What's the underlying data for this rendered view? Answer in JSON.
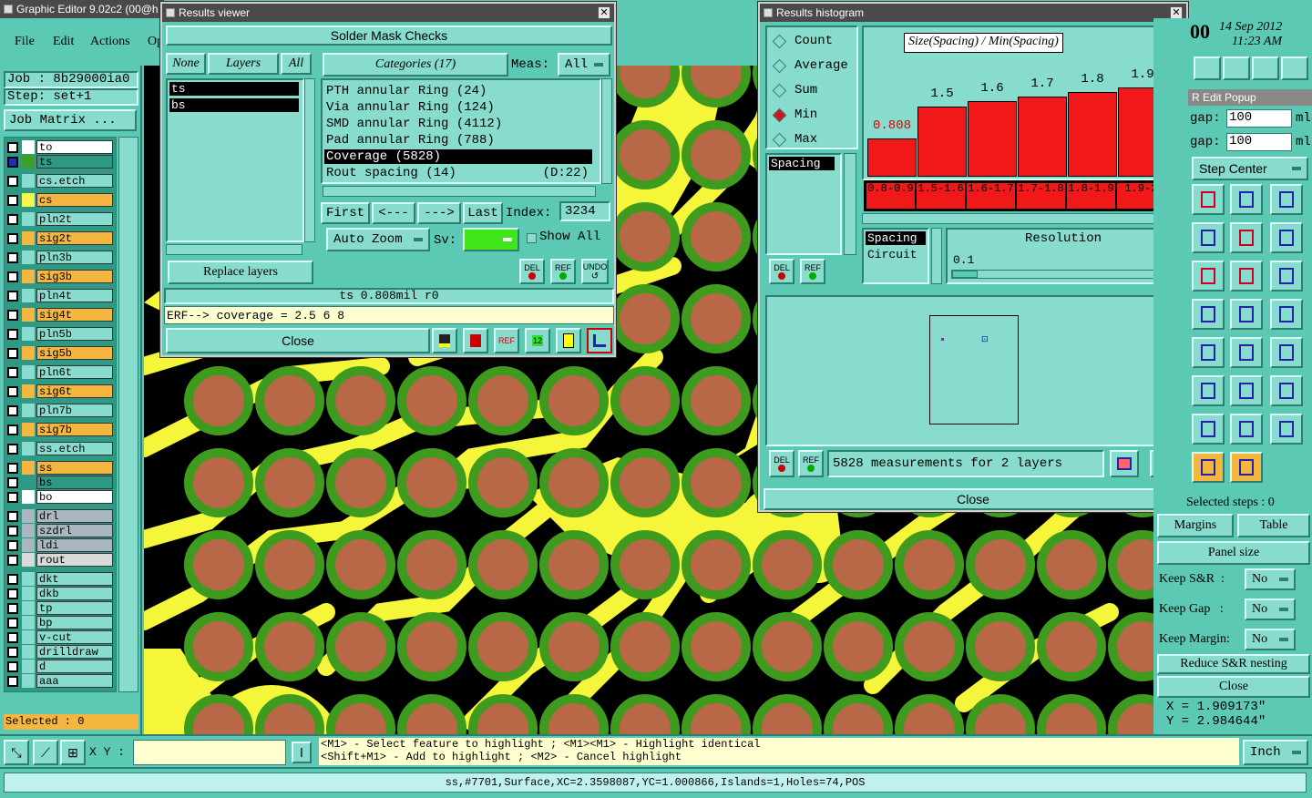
{
  "app": {
    "title": "Graphic Editor 9.02c2 (00@h",
    "clock_time": "11:23 AM",
    "clock_date": "14 Sep 2012",
    "clock_prefix": "00"
  },
  "menu": [
    {
      "label": "File"
    },
    {
      "label": "Edit"
    },
    {
      "label": "Actions"
    },
    {
      "label": "Op"
    }
  ],
  "job": {
    "job_line": "Job : 8b29000ia0",
    "step_line": "Step: set+1",
    "matrix_button": "Job Matrix ..."
  },
  "layers": [
    {
      "name": "to",
      "bg": "#ffffff",
      "cb": "#ffffff"
    },
    {
      "name": "ts",
      "bg": "#2e9a86",
      "cb": "#1c2dbf",
      "swatch": "#3d9e2b"
    },
    {
      "name": "cs.etch",
      "bg": "#87dccd",
      "cb": "#ffffff"
    },
    {
      "name": "cs",
      "bg": "#f5b63f",
      "cb": "#ffffff",
      "swatch": "#f5f54a"
    },
    {
      "name": "pln2t",
      "bg": "#87dccd",
      "cb": "#ffffff"
    },
    {
      "name": "sig2t",
      "bg": "#f5b63f",
      "cb": "#ffffff"
    },
    {
      "name": "pln3b",
      "bg": "#87dccd",
      "cb": "#ffffff"
    },
    {
      "name": "sig3b",
      "bg": "#f5b63f",
      "cb": "#ffffff"
    },
    {
      "name": "pln4t",
      "bg": "#87dccd",
      "cb": "#ffffff"
    },
    {
      "name": "sig4t",
      "bg": "#f5b63f",
      "cb": "#ffffff"
    },
    {
      "name": "pln5b",
      "bg": "#87dccd",
      "cb": "#ffffff"
    },
    {
      "name": "sig5b",
      "bg": "#f5b63f",
      "cb": "#ffffff"
    },
    {
      "name": "pln6t",
      "bg": "#87dccd",
      "cb": "#ffffff"
    },
    {
      "name": "sig6t",
      "bg": "#f5b63f",
      "cb": "#ffffff"
    },
    {
      "name": "pln7b",
      "bg": "#87dccd",
      "cb": "#ffffff"
    },
    {
      "name": "sig7b",
      "bg": "#f5b63f",
      "cb": "#ffffff"
    },
    {
      "name": "ss.etch",
      "bg": "#87dccd",
      "cb": "#ffffff"
    },
    {
      "name": "ss",
      "bg": "#f5b63f",
      "cb": "#ffffff"
    },
    {
      "name": "bs",
      "bg": "#2e9a86",
      "cb": "#ffffff"
    },
    {
      "name": "bo",
      "bg": "#ffffff",
      "cb": "#ffffff"
    },
    {
      "name": "drl",
      "bg": "#a9b8c0",
      "cb": "#ffffff"
    },
    {
      "name": "szdrl",
      "bg": "#a9b8c0",
      "cb": "#ffffff"
    },
    {
      "name": "ldi",
      "bg": "#a9b8c0",
      "cb": "#ffffff"
    },
    {
      "name": "rout",
      "bg": "#d9d9d9",
      "cb": "#ffffff"
    },
    {
      "name": "dkt",
      "bg": "#87dccd",
      "cb": "#ffffff"
    },
    {
      "name": "dkb",
      "bg": "#87dccd",
      "cb": "#ffffff"
    },
    {
      "name": "tp",
      "bg": "#87dccd",
      "cb": "#ffffff"
    },
    {
      "name": "bp",
      "bg": "#87dccd",
      "cb": "#ffffff"
    },
    {
      "name": "v-cut",
      "bg": "#87dccd",
      "cb": "#ffffff"
    },
    {
      "name": "drilldraw",
      "bg": "#87dccd",
      "cb": "#ffffff"
    },
    {
      "name": "d",
      "bg": "#87dccd",
      "cb": "#ffffff"
    },
    {
      "name": "aaa",
      "bg": "#87dccd",
      "cb": "#ffffff"
    }
  ],
  "layers_selected": "Selected : 0",
  "results_viewer": {
    "title": "Results viewer",
    "header": "Solder Mask Checks",
    "none_btn": "None",
    "layers_btn": "Layers",
    "all_btn": "All",
    "layer_list": [
      "ts",
      "bs"
    ],
    "categories_btn": "Categories (17)",
    "meas_label": "Meas:",
    "meas_value": "All",
    "categories": [
      {
        "name": "PTH annular Ring (24)",
        "extra": "",
        "selected": false
      },
      {
        "name": "Via annular Ring (124)",
        "extra": "",
        "selected": false
      },
      {
        "name": "SMD annular Ring (4112)",
        "extra": "",
        "selected": false
      },
      {
        "name": "Pad annular Ring (788)",
        "extra": "",
        "selected": false
      },
      {
        "name": "Coverage (5828)",
        "extra": "",
        "selected": true
      },
      {
        "name": "Rout spacing (14)",
        "extra": "(D:22)",
        "selected": false
      }
    ],
    "first": "First",
    "prev": "<---",
    "next": "--->",
    "last": "Last",
    "index_label": "Index:",
    "index_value": "3234",
    "auto_zoom": "Auto Zoom",
    "sv_label": "Sv:",
    "show_all": "Show All",
    "replace_layers": "Replace layers",
    "del": "DEL",
    "ref": "REF",
    "undo": "UNDO",
    "status": "ts 0.808mil  r0",
    "erf": "ERF--> coverage = 2.5 6 8",
    "close": "Close"
  },
  "histogram": {
    "title": "Results histogram",
    "modes": [
      {
        "label": "Count",
        "on": false
      },
      {
        "label": "Average",
        "on": false
      },
      {
        "label": "Sum",
        "on": false
      },
      {
        "label": "Min",
        "on": true
      },
      {
        "label": "Max",
        "on": false
      }
    ],
    "chart_title": "Size(Spacing) / Min(Spacing)",
    "bars": [
      {
        "value": "0.808",
        "range": "0.8-0.9",
        "v": 0.808,
        "red": true
      },
      {
        "value": "1.5",
        "range": "1.5-1.6",
        "v": 1.5
      },
      {
        "value": "1.6",
        "range": "1.6-1.7",
        "v": 1.6
      },
      {
        "value": "1.7",
        "range": "1.7-1.8",
        "v": 1.7
      },
      {
        "value": "1.8",
        "range": "1.8-1.9",
        "v": 1.8
      },
      {
        "value": "1.9",
        "range": "1.9-2",
        "v": 1.9
      }
    ],
    "list_item": "Spacing",
    "type_items": [
      "Spacing",
      "Circuit"
    ],
    "resolution_label": "Resolution",
    "resolution_value": "0.1",
    "measurements": "5828 measurements for 2 layers",
    "close": "Close",
    "del": "DEL",
    "ref": "REF"
  },
  "right_panel": {
    "popup_title": "R Edit Popup",
    "gap1_label": "gap:",
    "gap1_value": "100",
    "gap1_unit": "ml",
    "gap2_label": "gap:",
    "gap2_value": "100",
    "gap2_unit": "ml",
    "step_center": "Step Center",
    "selected_steps": "Selected steps : 0",
    "margins": "Margins",
    "table": "Table",
    "panel_size": "Panel size",
    "keep_sr_label": "Keep S&R  :",
    "keep_sr_value": "No",
    "keep_gap_label": "Keep Gap   :",
    "keep_gap_value": "No",
    "keep_margin_label": "Keep Margin:",
    "keep_margin_value": "No",
    "reduce": "Reduce S&R nesting",
    "close": "Close",
    "x_coord": "X = 1.909173\"",
    "y_coord": "Y = 2.984644\"",
    "units": "Inch"
  },
  "bottom": {
    "xy_label": "X Y :",
    "hint1": "<M1> - Select feature to highlight ; <M1><M1> - Highlight identical",
    "hint2": "<Shift+M1> - Add to highlight ; <M2> - Cancel highlight",
    "status": "ss,#7701,Surface,XC=2.3598087,YC=1.000866,Islands=1,Holes=74,POS"
  }
}
